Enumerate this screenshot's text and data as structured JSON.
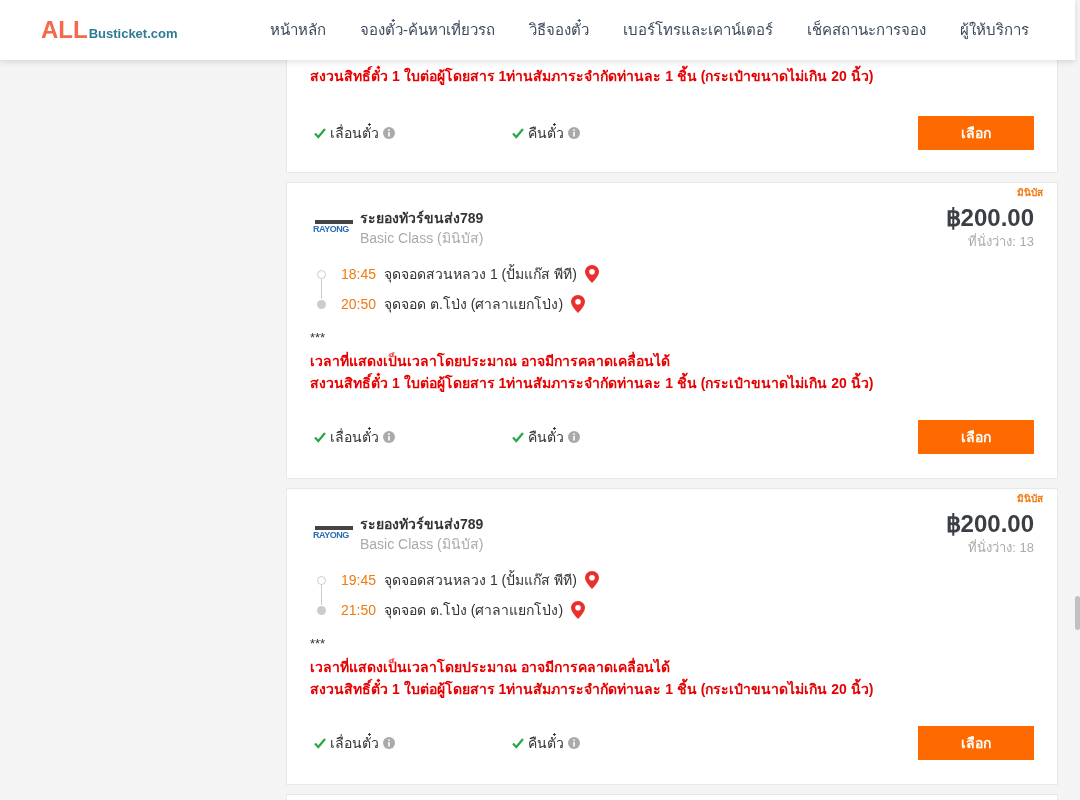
{
  "header": {
    "logo": {
      "primary": "ALL",
      "secondary": "Busticket.com"
    },
    "nav": [
      {
        "label": "หน้าหลัก"
      },
      {
        "label": "จองตั๋ว-ค้นหาเที่ยวรถ"
      },
      {
        "label": "วิธีจองตั๋ว"
      },
      {
        "label": "เบอร์โทรและเคาน์เตอร์"
      },
      {
        "label": "เช็คสถานะการจอง"
      },
      {
        "label": "ผู้ให้บริการ"
      }
    ]
  },
  "trips": [
    {
      "kind": "cut",
      "warnings": [
        "สงวนสิทธิ์ตั๋ว 1 ใบต่อผู้โดยสาร 1ท่านสัมภาระจำกัดท่านละ 1 ชิ้น (กระเป๋าขนาดไม่เกิน 20 นิ้ว)"
      ],
      "options": [
        {
          "label": "เลื่อนตั๋ว",
          "available": true
        },
        {
          "label": "คืนตั๋ว",
          "available": true
        }
      ],
      "button": "เลือก"
    },
    {
      "kind": "full",
      "badge": "มินิบัส",
      "operator": "ระยองทัวร์ขนส่ง789",
      "logo_text": "RAYONG",
      "class": "Basic Class (มินิบัส)",
      "price": "฿200.00",
      "seats": "ที่นั่งว่าง: 13",
      "stops": [
        {
          "time": "18:45",
          "place": "จุดจอดสวนหลวง 1 (ปั้มแก๊ส พีที)"
        },
        {
          "time": "20:50",
          "place": "จุดจอด ต.โป่ง (ศาลาแยกโป่ง)"
        }
      ],
      "note": "***",
      "warnings": [
        "เวลาที่แสดงเป็นเวลาโดยประมาณ อาจมีการคลาดเคลื่อนได้",
        "สงวนสิทธิ์ตั๋ว 1 ใบต่อผู้โดยสาร 1ท่านสัมภาระจำกัดท่านละ 1 ชิ้น (กระเป๋าขนาดไม่เกิน 20 นิ้ว)"
      ],
      "options": [
        {
          "label": "เลื่อนตั๋ว",
          "available": true
        },
        {
          "label": "คืนตั๋ว",
          "available": true
        }
      ],
      "button": "เลือก"
    },
    {
      "kind": "full",
      "badge": "มินิบัส",
      "operator": "ระยองทัวร์ขนส่ง789",
      "logo_text": "RAYONG",
      "class": "Basic Class (มินิบัส)",
      "price": "฿200.00",
      "seats": "ที่นั่งว่าง: 18",
      "stops": [
        {
          "time": "19:45",
          "place": "จุดจอดสวนหลวง 1 (ปั้มแก๊ส พีที)"
        },
        {
          "time": "21:50",
          "place": "จุดจอด ต.โป่ง (ศาลาแยกโป่ง)"
        }
      ],
      "note": "***",
      "warnings": [
        "เวลาที่แสดงเป็นเวลาโดยประมาณ อาจมีการคลาดเคลื่อนได้",
        "สงวนสิทธิ์ตั๋ว 1 ใบต่อผู้โดยสาร 1ท่านสัมภาระจำกัดท่านละ 1 ชิ้น (กระเป๋าขนาดไม่เกิน 20 นิ้ว)"
      ],
      "options": [
        {
          "label": "เลื่อนตั๋ว",
          "available": true
        },
        {
          "label": "คืนตั๋ว",
          "available": true
        }
      ],
      "button": "เลือก"
    }
  ]
}
